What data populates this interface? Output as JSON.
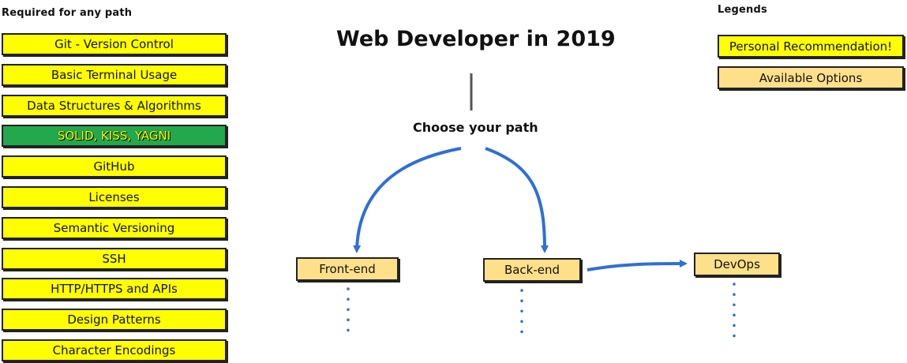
{
  "required": {
    "heading": "Required for any path",
    "items": [
      "Git - Version Control",
      "Basic Terminal Usage",
      "Data Structures & Algorithms",
      "SOLID, KISS, YAGNI",
      "GitHub",
      "Licenses",
      "Semantic Versioning",
      "SSH",
      "HTTP/HTTPS and APIs",
      "Design Patterns",
      "Character Encodings"
    ]
  },
  "title": "Web Developer in 2019",
  "choose_label": "Choose your path",
  "paths": {
    "frontend": "Front-end",
    "backend": "Back-end",
    "devops": "DevOps"
  },
  "legend": {
    "heading": "Legends",
    "recommendation": "Personal Recommendation!",
    "options": "Available Options"
  },
  "colors": {
    "recommended": "#ffff00",
    "option": "#ffe08a",
    "highlight": "#23a84e",
    "arrow": "#2f6fd6"
  }
}
